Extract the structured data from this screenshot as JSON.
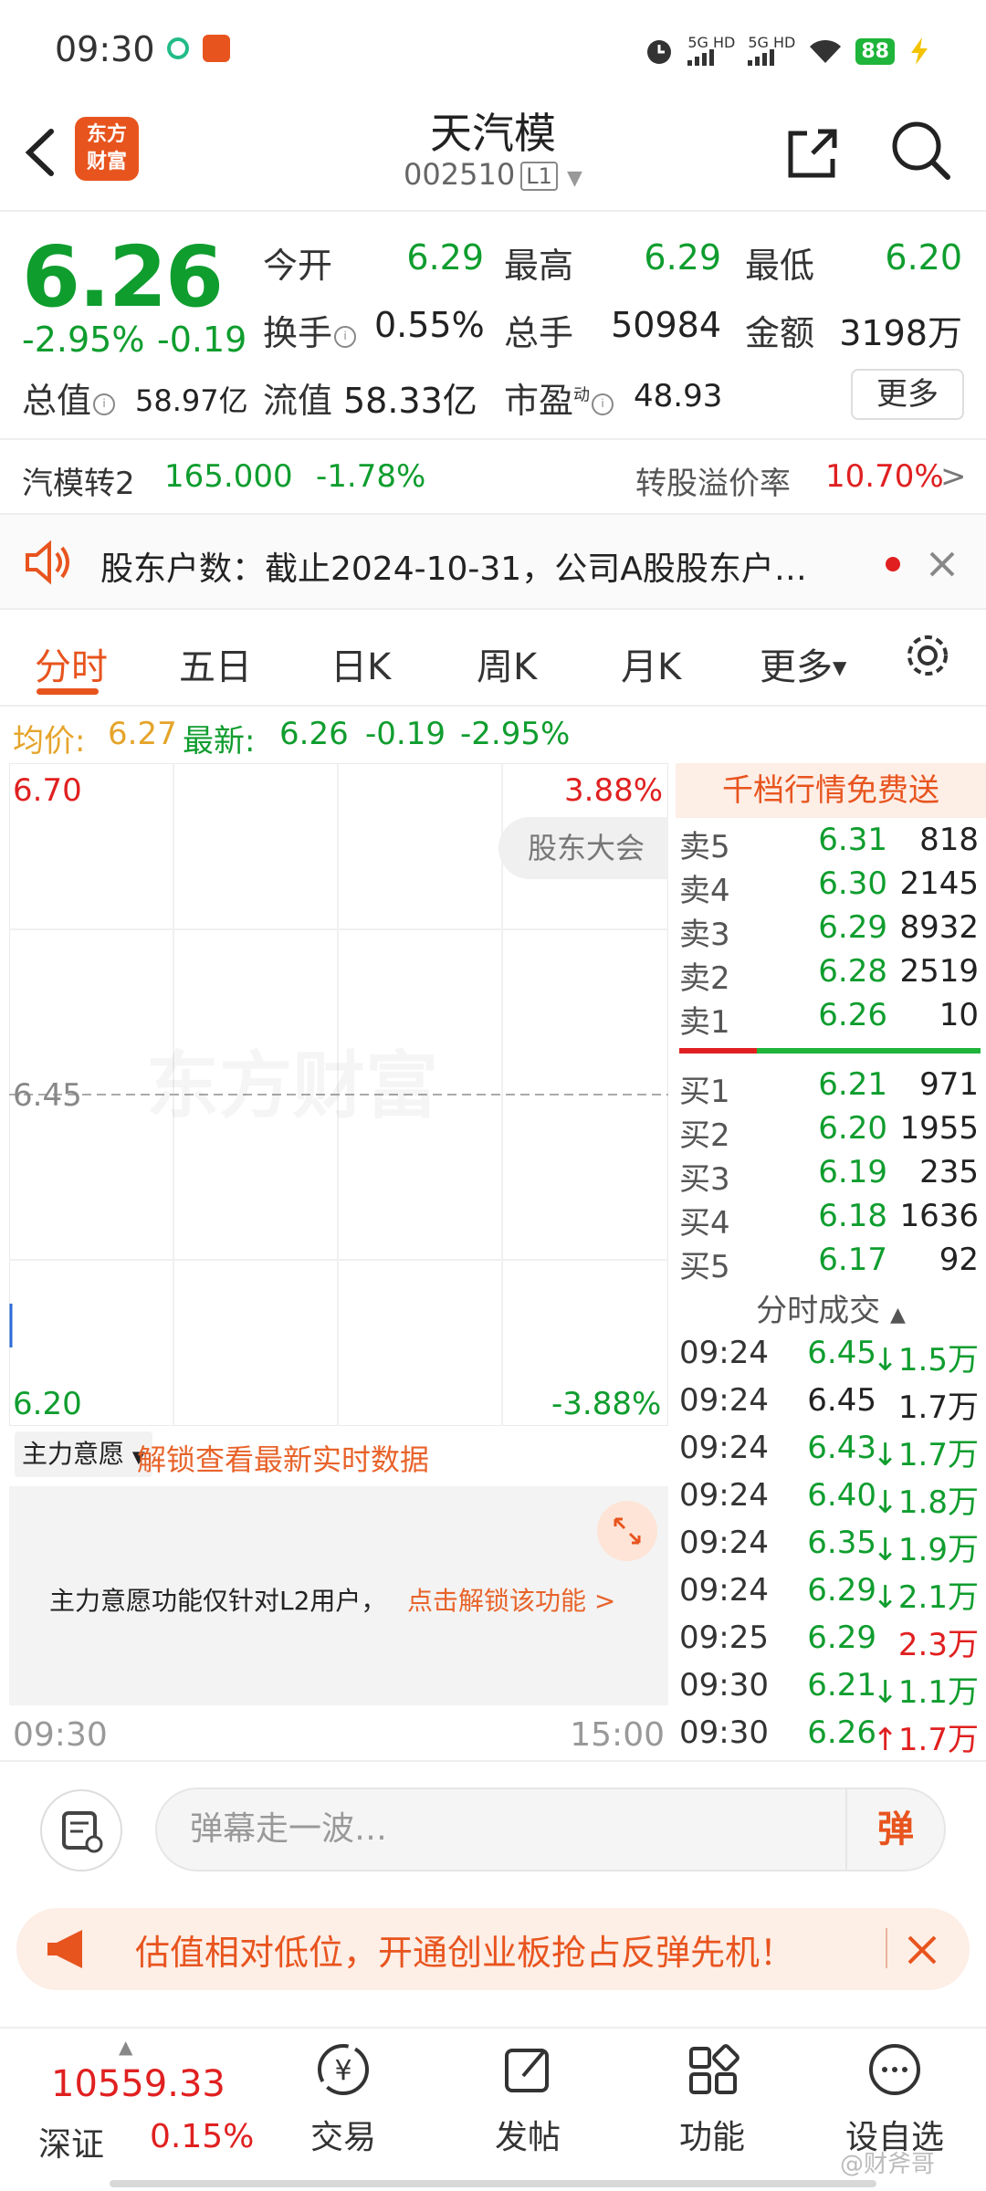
{
  "status_bar": {
    "time": "09:30",
    "net1": "5G HD",
    "net2": "5G HD",
    "battery": "88"
  },
  "header": {
    "back_icon": "back-arrow-icon",
    "logo_line1": "东方",
    "logo_line2": "财富",
    "stock_name": "天汽模",
    "stock_code": "002510",
    "level": "L1"
  },
  "quote": {
    "price": "6.26",
    "change_pct": "-2.95%",
    "change_val": "-0.19",
    "open_label": "今开",
    "open": "6.29",
    "high_label": "最高",
    "high": "6.29",
    "low_label": "最低",
    "low": "6.20",
    "turnover_label": "换手",
    "turnover": "0.55%",
    "volume_label": "总手",
    "volume": "50984",
    "amount_label": "金额",
    "amount": "3198万",
    "mcap_label": "总值",
    "mcap": "58.97亿",
    "float_label": "流值",
    "float": "58.33亿",
    "pe_label": "市盈",
    "pe_sup": "动",
    "pe": "48.93",
    "more": "更多"
  },
  "bond": {
    "name": "汽模转2",
    "price": "165.000",
    "change": "-1.78%",
    "premium_label": "转股溢价率",
    "premium": "10.70%",
    "arrow": ">"
  },
  "announce": {
    "text": "股东户数：截止2024-10-31，公司A股股东户…"
  },
  "tabs": [
    {
      "label": "分时"
    },
    {
      "label": "五日"
    },
    {
      "label": "日K"
    },
    {
      "label": "周K"
    },
    {
      "label": "月K"
    },
    {
      "label": "更多"
    }
  ],
  "avg_row": {
    "avg_label": "均价:",
    "avg": "6.27",
    "latest_label": "最新:",
    "latest": "6.26",
    "chg": "-0.19",
    "pct": "-2.95%"
  },
  "chart": {
    "top_price": "6.70",
    "top_pct": "3.88%",
    "mid_price": "6.45",
    "bottom_price": "6.20",
    "bottom_pct": "-3.88%",
    "meeting_tag": "股东大会",
    "watermark": "东方财富",
    "time_start": "09:30",
    "time_end": "15:00"
  },
  "main_force": {
    "select": "主力意愿",
    "unlock_text": "解锁查看最新实时数据",
    "notice": "主力意愿功能仅针对L2用户，",
    "notice_link": "点击解锁该功能 >"
  },
  "orderbook": {
    "banner": "千档行情免费送",
    "asks": [
      {
        "label": "卖5",
        "price": "6.31",
        "vol": "818"
      },
      {
        "label": "卖4",
        "price": "6.30",
        "vol": "2145"
      },
      {
        "label": "卖3",
        "price": "6.29",
        "vol": "8932"
      },
      {
        "label": "卖2",
        "price": "6.28",
        "vol": "2519"
      },
      {
        "label": "卖1",
        "price": "6.26",
        "vol": "10"
      }
    ],
    "bids": [
      {
        "label": "买1",
        "price": "6.21",
        "vol": "971"
      },
      {
        "label": "买2",
        "price": "6.20",
        "vol": "1955"
      },
      {
        "label": "买3",
        "price": "6.19",
        "vol": "235"
      },
      {
        "label": "买4",
        "price": "6.18",
        "vol": "1636"
      },
      {
        "label": "买5",
        "price": "6.17",
        "vol": "92"
      }
    ]
  },
  "trades": {
    "title": "分时成交",
    "rows": [
      {
        "time": "09:24",
        "price": "6.45",
        "vol": "↓1.5万",
        "color": "#0f9d2e",
        "vcolor": "#0f9d2e"
      },
      {
        "time": "09:24",
        "price": "6.45",
        "vol": "1.7万",
        "color": "#222222",
        "vcolor": "#222222"
      },
      {
        "time": "09:24",
        "price": "6.43",
        "vol": "↓1.7万",
        "color": "#0f9d2e",
        "vcolor": "#0f9d2e"
      },
      {
        "time": "09:24",
        "price": "6.40",
        "vol": "↓1.8万",
        "color": "#0f9d2e",
        "vcolor": "#0f9d2e"
      },
      {
        "time": "09:24",
        "price": "6.35",
        "vol": "↓1.9万",
        "color": "#0f9d2e",
        "vcolor": "#0f9d2e"
      },
      {
        "time": "09:24",
        "price": "6.29",
        "vol": "↓2.1万",
        "color": "#0f9d2e",
        "vcolor": "#0f9d2e"
      },
      {
        "time": "09:25",
        "price": "6.29",
        "vol": "2.3万",
        "color": "#0f9d2e",
        "vcolor": "#e02020"
      },
      {
        "time": "09:30",
        "price": "6.21",
        "vol": "↓1.1万",
        "color": "#0f9d2e",
        "vcolor": "#0f9d2e"
      },
      {
        "time": "09:30",
        "price": "6.26",
        "vol": "↑1.7万",
        "color": "#0f9d2e",
        "vcolor": "#e02020"
      }
    ]
  },
  "comment": {
    "placeholder": "弹幕走一波…",
    "send": "弹"
  },
  "promo": {
    "text": "估值相对低位，开通创业板抢占反弹先机！"
  },
  "bottom_nav": {
    "index_value": "10559.33",
    "index_name": "深证",
    "index_pct": "0.15%",
    "items": [
      {
        "label": "交易"
      },
      {
        "label": "发帖"
      },
      {
        "label": "功能"
      },
      {
        "label": "设自选"
      }
    ]
  },
  "weibo": "@财斧哥",
  "colors": {
    "accent": "#e8541e",
    "down": "#0f9d2e",
    "up": "#e02020"
  }
}
